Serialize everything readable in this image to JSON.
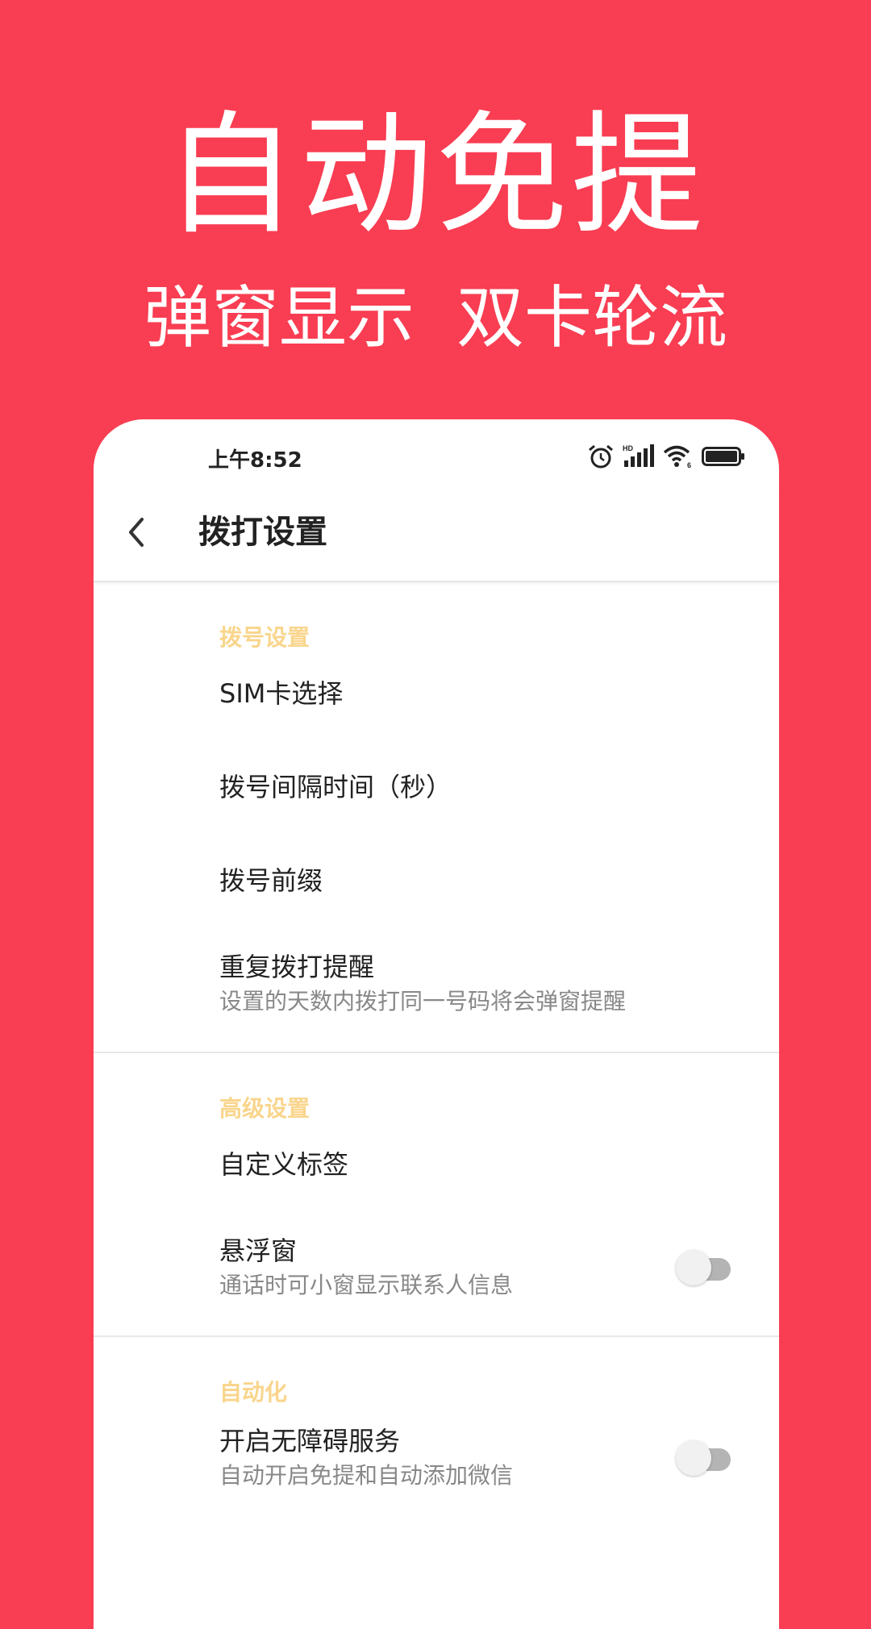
{
  "promo": {
    "headline": "自动免提",
    "subline_1": "弹窗显示",
    "subline_2": "双卡轮流"
  },
  "status_bar": {
    "time": "上午8:52",
    "hd_label": "HD",
    "wifi_badge": "6",
    "icons": [
      "alarm-icon",
      "signal-icon",
      "wifi-icon",
      "battery-icon"
    ]
  },
  "appbar": {
    "title": "拨打设置",
    "back_icon": "chevron-left-icon"
  },
  "sections": [
    {
      "title": "拨号设置",
      "items": [
        {
          "title": "SIM卡选择"
        },
        {
          "title": "拨号间隔时间（秒）"
        },
        {
          "title": "拨号前缀"
        },
        {
          "title": "重复拨打提醒",
          "subtitle": "设置的天数内拨打同一号码将会弹窗提醒"
        }
      ]
    },
    {
      "title": "高级设置",
      "items": [
        {
          "title": "自定义标签"
        },
        {
          "title": "悬浮窗",
          "subtitle": "通话时可小窗显示联系人信息",
          "toggle": false
        }
      ]
    },
    {
      "title": "自动化",
      "items": [
        {
          "title": "开启无障碍服务",
          "subtitle": "自动开启免提和自动添加微信",
          "toggle": false
        }
      ]
    }
  ],
  "colors": {
    "background": "#f93d52",
    "section_title": "#f9d58c",
    "toggle_off_track": "#b4b4b4"
  }
}
